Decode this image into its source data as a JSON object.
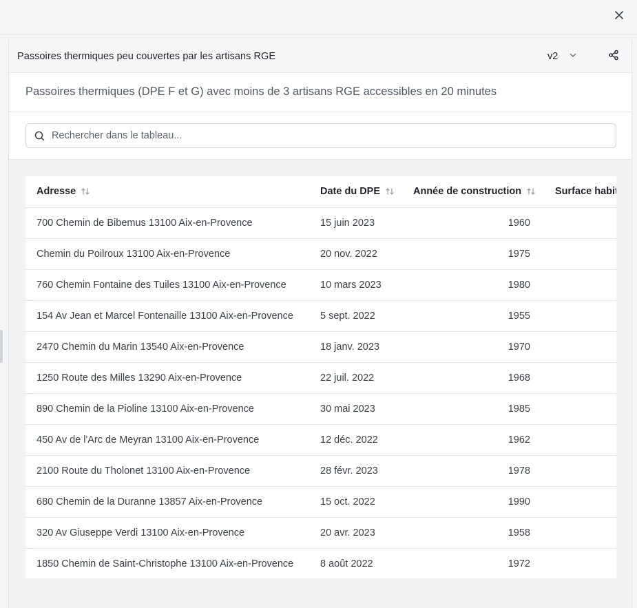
{
  "window": {
    "close_icon": "close-icon"
  },
  "panel": {
    "title": "Passoires thermiques peu couvertes par les artisans RGE",
    "version": "v2",
    "version_icon": "chevron-down-icon",
    "share_icon": "share-icon",
    "subtitle": "Passoires thermiques (DPE F et G) avec moins de 3 artisans RGE accessibles en 20 minutes"
  },
  "search": {
    "icon": "search-icon",
    "placeholder": "Rechercher dans le tableau...",
    "value": ""
  },
  "table": {
    "columns": [
      {
        "label": "Adresse",
        "sortable": true
      },
      {
        "label": "Date du DPE",
        "sortable": true
      },
      {
        "label": "Année de construction",
        "sortable": true
      },
      {
        "label": "Surface habit",
        "sortable": false
      }
    ],
    "rows": [
      {
        "adresse": "700 Chemin de Bibemus 13100 Aix-en-Provence",
        "date": "15 juin 2023",
        "annee": "1960",
        "surface": ""
      },
      {
        "adresse": "Chemin du Poilroux 13100 Aix-en-Provence",
        "date": "20 nov. 2022",
        "annee": "1975",
        "surface": ""
      },
      {
        "adresse": "760 Chemin Fontaine des Tuiles 13100 Aix-en-Provence",
        "date": "10 mars 2023",
        "annee": "1980",
        "surface": ""
      },
      {
        "adresse": "154 Av Jean et Marcel Fontenaille 13100 Aix-en-Provence",
        "date": "5 sept. 2022",
        "annee": "1955",
        "surface": ""
      },
      {
        "adresse": "2470 Chemin du Marin 13540 Aix-en-Provence",
        "date": "18 janv. 2023",
        "annee": "1970",
        "surface": ""
      },
      {
        "adresse": "1250 Route des Milles 13290 Aix-en-Provence",
        "date": "22 juil. 2022",
        "annee": "1968",
        "surface": ""
      },
      {
        "adresse": "890 Chemin de la Pioline 13100 Aix-en-Provence",
        "date": "30 mai 2023",
        "annee": "1985",
        "surface": ""
      },
      {
        "adresse": "450 Av de l'Arc de Meyran 13100 Aix-en-Provence",
        "date": "12 déc. 2022",
        "annee": "1962",
        "surface": ""
      },
      {
        "adresse": "2100 Route du Tholonet 13100 Aix-en-Provence",
        "date": "28 févr. 2023",
        "annee": "1978",
        "surface": ""
      },
      {
        "adresse": "680 Chemin de la Duranne 13857 Aix-en-Provence",
        "date": "15 oct. 2022",
        "annee": "1990",
        "surface": ""
      },
      {
        "adresse": "320 Av Giuseppe Verdi 13100 Aix-en-Provence",
        "date": "20 avr. 2023",
        "annee": "1958",
        "surface": ""
      },
      {
        "adresse": "1850 Chemin de Saint-Christophe 13100 Aix-en-Provence",
        "date": "8 août 2022",
        "annee": "1972",
        "surface": ""
      }
    ]
  }
}
